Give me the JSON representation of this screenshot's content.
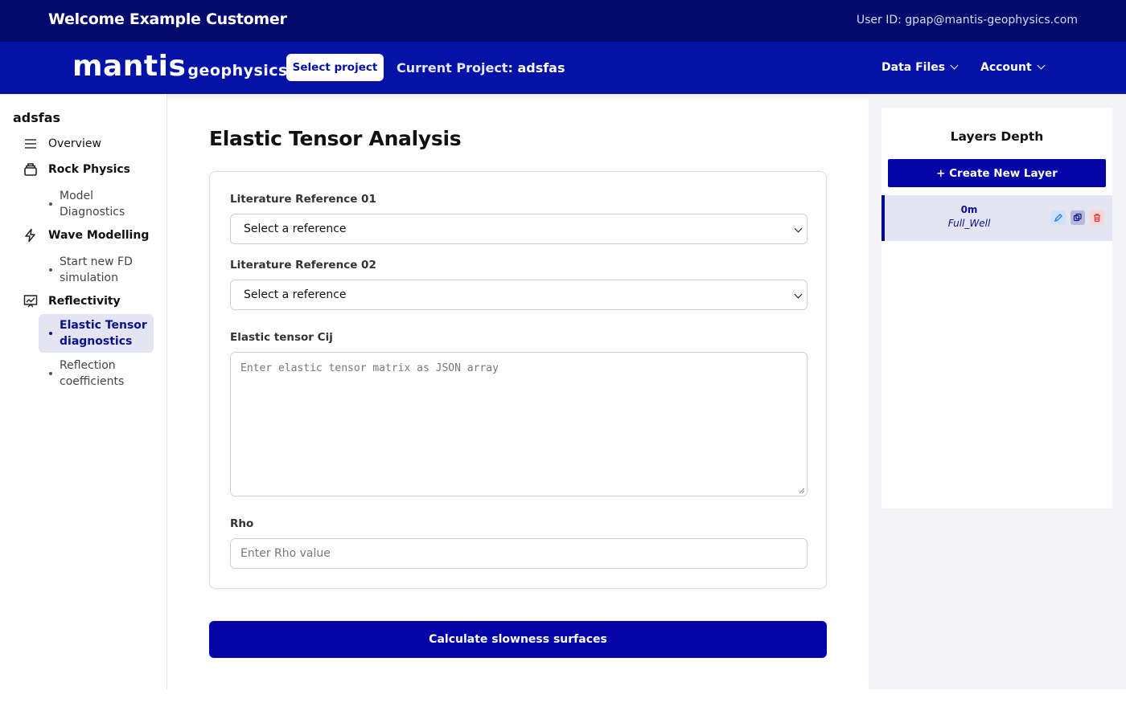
{
  "topbar": {
    "welcome": "Welcome Example Customer",
    "user_id": "User ID: gpap@mantis-geophysics.com"
  },
  "navbar": {
    "logo_main": "mantis",
    "logo_sub": "geophysics",
    "select_project": "Select project",
    "current_project_label": "Current Project:",
    "current_project_name": "adsfas",
    "menus": [
      "Data Files",
      "Account"
    ]
  },
  "sidebar": {
    "project": "adsfas",
    "items": [
      {
        "label": "Overview",
        "icon": "menu-icon"
      },
      {
        "label": "Rock Physics",
        "icon": "layers-icon"
      },
      {
        "label": "Wave Modelling",
        "icon": "lightning-icon"
      },
      {
        "label": "Reflectivity",
        "icon": "chart-icon"
      }
    ],
    "subitems": {
      "model_diagnostics": "Model Diagnostics",
      "start_fd": "Start new FD simulation",
      "elastic_tensor": "Elastic Tensor diagnostics",
      "reflection_coeffs": "Reflection coefficients"
    }
  },
  "main": {
    "title": "Elastic Tensor Analysis",
    "ref1_label": "Literature Reference 01",
    "ref1_value": "Select a reference",
    "ref2_label": "Literature Reference 02",
    "ref2_value": "Select a reference",
    "cij_label": "Elastic tensor Cij",
    "cij_placeholder": "Enter elastic tensor matrix as JSON array",
    "rho_label": "Rho",
    "rho_placeholder": "Enter Rho value",
    "calculate": "Calculate slowness surfaces"
  },
  "layers": {
    "title": "Layers Depth",
    "create": "+ Create New Layer",
    "rows": [
      {
        "depth": "0m",
        "name": "Full_Well"
      }
    ]
  },
  "colors": {
    "topbar": "#030a6e",
    "navbar": "#0412a8",
    "accent": "#0404a8",
    "active_bg": "#e4e4f2"
  }
}
